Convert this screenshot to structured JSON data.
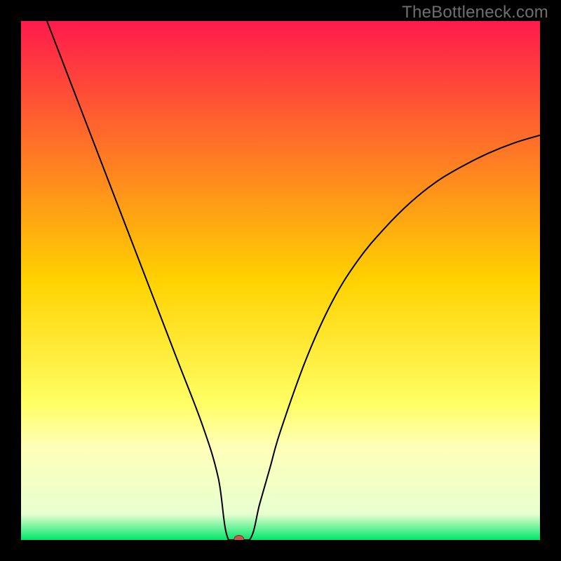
{
  "watermark": "TheBottleneck.com",
  "chart_data": {
    "type": "line",
    "title": "",
    "xlabel": "",
    "ylabel": "",
    "xlim": [
      0,
      100
    ],
    "ylim": [
      0,
      100
    ],
    "background_gradient": {
      "stops": [
        {
          "offset": 0.0,
          "color": "#ff1a4c"
        },
        {
          "offset": 0.5,
          "color": "#ffd200"
        },
        {
          "offset": 0.74,
          "color": "#ffff66"
        },
        {
          "offset": 0.82,
          "color": "#ffffb8"
        },
        {
          "offset": 0.95,
          "color": "#e8ffd0"
        },
        {
          "offset": 1.0,
          "color": "#00e66b"
        }
      ]
    },
    "series": [
      {
        "name": "bottleneck-curve",
        "color": "#000000",
        "width": 2,
        "x": [
          5,
          10,
          15,
          20,
          25,
          30,
          35,
          38,
          40,
          41,
          42,
          44,
          46,
          48,
          50,
          55,
          60,
          65,
          70,
          75,
          80,
          85,
          90,
          95,
          100
        ],
        "y": [
          100,
          87,
          74,
          61,
          48,
          35,
          22,
          12,
          5,
          2,
          0,
          2,
          7,
          14,
          21,
          35,
          46,
          54,
          60,
          65,
          69,
          72,
          74.5,
          76.5,
          78
        ]
      }
    ],
    "markers": [
      {
        "name": "optimal-point",
        "x": 42,
        "y": 0,
        "color_fill": "#c7564e",
        "color_stroke": "#7c2f2a",
        "r": 7
      }
    ],
    "flat_segment": {
      "x_start": 40,
      "x_end": 44,
      "y": 0
    }
  }
}
